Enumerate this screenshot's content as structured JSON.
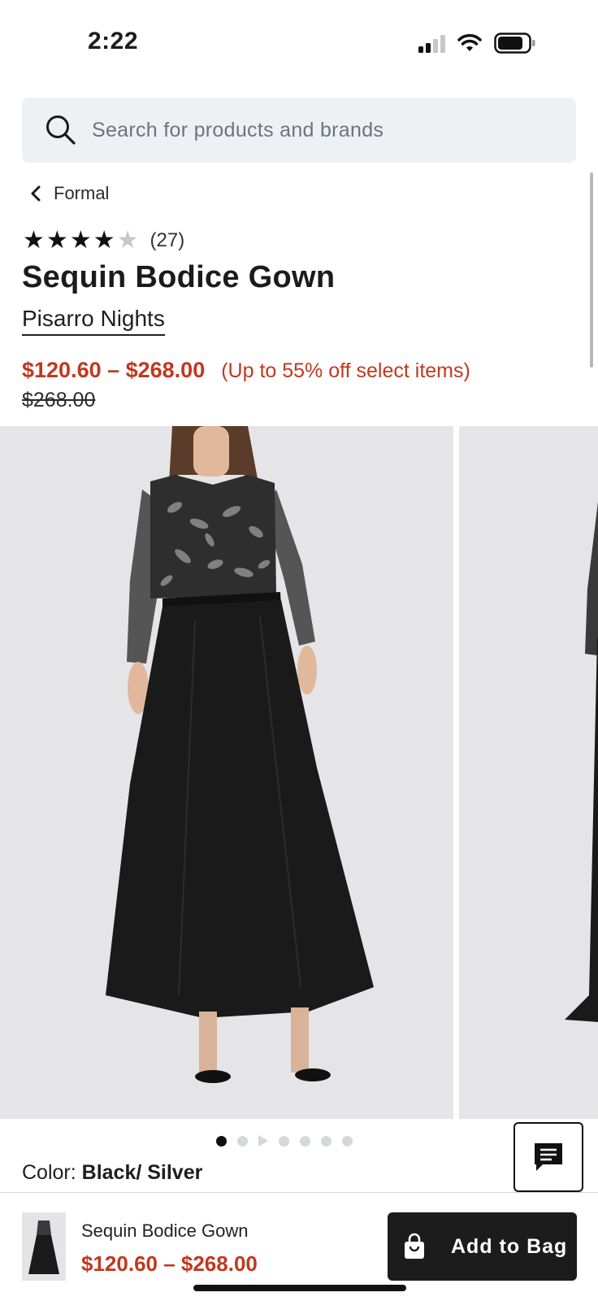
{
  "status_bar": {
    "time": "2:22"
  },
  "search": {
    "placeholder": "Search for products and brands"
  },
  "breadcrumb": {
    "label": "Formal"
  },
  "rating": {
    "stars_filled": 4,
    "stars_total": 5,
    "count": "(27)"
  },
  "product": {
    "title": "Sequin Bodice Gown",
    "brand": "Pisarro Nights",
    "price_range": "$120.60 – $268.00",
    "promo": "(Up to 55% off select items)",
    "original_price": "$268.00"
  },
  "gallery": {
    "dots_total": 7,
    "active_index": 0,
    "arrow_index": 2
  },
  "color": {
    "label": "Color:",
    "value": "Black/ Silver"
  },
  "bottom_bar": {
    "title": "Sequin Bodice Gown",
    "price": "$120.60 – $268.00",
    "add_to_bag_label": "Add to Bag"
  },
  "icons": {
    "search": "search-icon",
    "back": "chevron-left-icon",
    "chat": "chat-icon",
    "bag": "shopping-bag-icon",
    "signal": "cellular-signal-icon",
    "wifi": "wifi-icon",
    "battery": "battery-icon"
  },
  "colors": {
    "accent_price": "#c0381f",
    "button_dark": "#1c1c1c",
    "search_bg": "#eef1f4"
  }
}
